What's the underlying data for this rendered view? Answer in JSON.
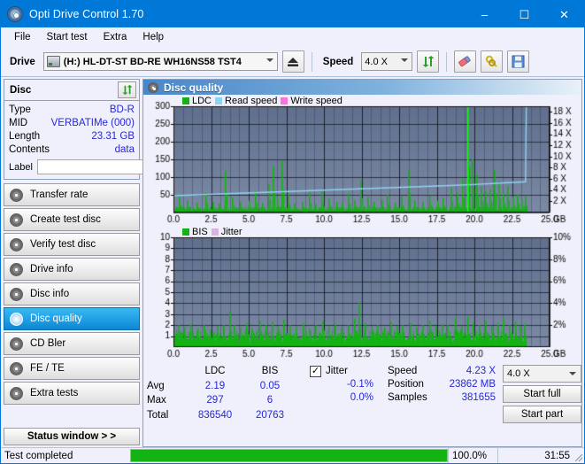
{
  "window": {
    "title": "Opti Drive Control 1.70",
    "icon": "disc-icon",
    "minimize": "–",
    "maximize": "☐",
    "close": "✕"
  },
  "menu": {
    "items": [
      "File",
      "Start test",
      "Extra",
      "Help"
    ]
  },
  "toolbar": {
    "drive_label": "Drive",
    "drive_value": "(H:)  HL-DT-ST BD-RE  WH16NS58 TST4",
    "eject_icon": "eject-icon",
    "speed_label": "Speed",
    "speed_value": "4.0 X",
    "refresh_icon": "refresh-icon",
    "erase_icon": "eraser-icon",
    "tools_icon": "keys-icon",
    "save_icon": "save-icon"
  },
  "disc_panel": {
    "title": "Disc",
    "refresh_icon": "refresh-icon",
    "rows": [
      {
        "key": "Type",
        "value": "BD-R"
      },
      {
        "key": "MID",
        "value": "VERBATIMe (000)"
      },
      {
        "key": "Length",
        "value": "23.31 GB"
      },
      {
        "key": "Contents",
        "value": "data"
      }
    ],
    "label_key": "Label",
    "label_value": "",
    "label_placeholder": "",
    "disc_button_icon": "cd-icon"
  },
  "sidebar": {
    "items": [
      {
        "label": "Transfer rate",
        "icon": "cd-icon",
        "active": false
      },
      {
        "label": "Create test disc",
        "icon": "cd-icon",
        "active": false
      },
      {
        "label": "Verify test disc",
        "icon": "cd-icon",
        "active": false
      },
      {
        "label": "Drive info",
        "icon": "cd-icon",
        "active": false
      },
      {
        "label": "Disc info",
        "icon": "cd-icon",
        "active": false
      },
      {
        "label": "Disc quality",
        "icon": "cd-icon",
        "active": true
      },
      {
        "label": "CD Bler",
        "icon": "cd-icon",
        "active": false
      },
      {
        "label": "FE / TE",
        "icon": "cd-icon",
        "active": false
      },
      {
        "label": "Extra tests",
        "icon": "cd-icon",
        "active": false
      }
    ],
    "status_button": "Status window > >"
  },
  "main": {
    "header_title": "Disc quality",
    "header_icon": "cd-icon"
  },
  "stats": {
    "col_headers": [
      "LDC",
      "BIS"
    ],
    "rows": [
      {
        "label": "Avg",
        "ldc": "2.19",
        "bis": "0.05",
        "jitter": "-0.1%"
      },
      {
        "label": "Max",
        "ldc": "297",
        "bis": "6",
        "jitter": "0.0%"
      },
      {
        "label": "Total",
        "ldc": "836540",
        "bis": "20763",
        "jitter": ""
      }
    ],
    "jitter_label": "Jitter",
    "jitter_checked": true,
    "speed_label": "Speed",
    "speed_value": "4.23 X",
    "position_label": "Position",
    "position_value": "23862 MB",
    "samples_label": "Samples",
    "samples_value": "381655",
    "speed_select": "4.0 X",
    "start_full": "Start full",
    "start_part": "Start part"
  },
  "statusbar": {
    "text": "Test completed",
    "percent_text": "100.0%",
    "percent_value": 100,
    "time": "31:55"
  },
  "colors": {
    "accent": "#0078d7",
    "ldc_green": "#12b312",
    "read_speed": "#8fd3f4",
    "write_speed": "#ff6fe0",
    "jitter": "#d9b3e0",
    "plot_bg": "#6b7b99",
    "value_blue": "#2727d4"
  },
  "chart_data": [
    {
      "type": "bar",
      "title": "Disc quality - LDC",
      "xlabel": "GB",
      "ylabel": "LDC",
      "xlim": [
        0,
        25.0
      ],
      "ylim": [
        0,
        300
      ],
      "xticks": [
        "0.0",
        "2.5",
        "5.0",
        "7.5",
        "10.0",
        "12.5",
        "15.0",
        "17.5",
        "20.0",
        "22.5",
        "25.0"
      ],
      "xtick_unit": "GB",
      "yticks": [
        0,
        50,
        100,
        150,
        200,
        250,
        300
      ],
      "y2ticks": [
        "2 X",
        "4 X",
        "6 X",
        "8 X",
        "10 X",
        "12 X",
        "14 X",
        "16 X",
        "18 X"
      ],
      "y2lim": [
        0,
        19
      ],
      "grid": true,
      "legend": [
        {
          "name": "LDC",
          "color": "#12b312"
        },
        {
          "name": "Read speed",
          "color": "#8fd3f4"
        },
        {
          "name": "Write speed",
          "color": "#ff6fe0"
        }
      ],
      "series": [
        {
          "name": "LDC",
          "kind": "bars",
          "color": "#12b312",
          "baseline": 12,
          "spikes": [
            [
              0.35,
              48
            ],
            [
              0.9,
              35
            ],
            [
              1.5,
              28
            ],
            [
              2.1,
              55
            ],
            [
              2.6,
              30
            ],
            [
              3.0,
              26
            ],
            [
              3.4,
              118
            ],
            [
              3.9,
              44
            ],
            [
              4.4,
              30
            ],
            [
              5.0,
              34
            ],
            [
              5.4,
              60
            ],
            [
              5.9,
              28
            ],
            [
              6.3,
              80
            ],
            [
              6.6,
              132
            ],
            [
              6.9,
              40
            ],
            [
              7.2,
              146
            ],
            [
              7.6,
              52
            ],
            [
              8.0,
              26
            ],
            [
              8.5,
              30
            ],
            [
              9.0,
              58
            ],
            [
              9.4,
              24
            ],
            [
              9.8,
              62
            ],
            [
              10.3,
              40
            ],
            [
              10.8,
              30
            ],
            [
              11.2,
              26
            ],
            [
              11.6,
              55
            ],
            [
              12.0,
              34
            ],
            [
              12.4,
              90
            ],
            [
              12.9,
              44
            ],
            [
              13.3,
              30
            ],
            [
              13.8,
              36
            ],
            [
              14.2,
              52
            ],
            [
              14.7,
              28
            ],
            [
              15.1,
              46
            ],
            [
              15.6,
              120
            ],
            [
              16.0,
              34
            ],
            [
              16.5,
              30
            ],
            [
              17.0,
              48
            ],
            [
              17.5,
              34
            ],
            [
              17.9,
              42
            ],
            [
              18.4,
              70
            ],
            [
              18.8,
              56
            ],
            [
              19.2,
              96
            ],
            [
              19.5,
              290
            ],
            [
              19.8,
              150
            ],
            [
              20.1,
              108
            ],
            [
              20.4,
              72
            ],
            [
              20.7,
              60
            ],
            [
              21.0,
              66
            ],
            [
              21.3,
              120
            ],
            [
              21.6,
              88
            ],
            [
              21.9,
              56
            ],
            [
              22.2,
              74
            ],
            [
              22.5,
              44
            ],
            [
              22.8,
              52
            ],
            [
              23.1,
              38
            ],
            [
              23.35,
              46
            ]
          ]
        },
        {
          "name": "Read speed",
          "kind": "line",
          "color": "#8fd3f4",
          "points": [
            [
              0.0,
              3.0
            ],
            [
              2.0,
              3.2
            ],
            [
              4.0,
              3.4
            ],
            [
              6.0,
              3.6
            ],
            [
              8.0,
              3.8
            ],
            [
              10.0,
              4.0
            ],
            [
              12.0,
              4.2
            ],
            [
              14.0,
              4.4
            ],
            [
              16.0,
              4.6
            ],
            [
              18.0,
              4.8
            ],
            [
              20.0,
              5.0
            ],
            [
              22.0,
              5.3
            ],
            [
              23.4,
              5.5
            ],
            [
              23.45,
              19.0
            ]
          ]
        }
      ]
    },
    {
      "type": "bar",
      "title": "Disc quality - BIS",
      "xlabel": "GB",
      "ylabel": "BIS",
      "xlim": [
        0,
        25.0
      ],
      "ylim": [
        0,
        10
      ],
      "xticks": [
        "0.0",
        "2.5",
        "5.0",
        "7.5",
        "10.0",
        "12.5",
        "15.0",
        "17.5",
        "20.0",
        "22.5",
        "25.0"
      ],
      "xtick_unit": "GB",
      "yticks": [
        1,
        2,
        3,
        4,
        5,
        6,
        7,
        8,
        9,
        10
      ],
      "y2ticks": [
        "2%",
        "4%",
        "6%",
        "8%",
        "10%"
      ],
      "y2lim": [
        0,
        10
      ],
      "grid": true,
      "legend": [
        {
          "name": "BIS",
          "color": "#12b312"
        },
        {
          "name": "Jitter",
          "color": "#d9b3e0"
        }
      ],
      "series": [
        {
          "name": "BIS",
          "kind": "bars",
          "color": "#12b312",
          "baseline": 1.1,
          "spikes": [
            [
              0.3,
              2.0
            ],
            [
              0.7,
              1.8
            ],
            [
              1.1,
              2.1
            ],
            [
              1.6,
              1.7
            ],
            [
              2.0,
              2.0
            ],
            [
              2.4,
              1.6
            ],
            [
              2.9,
              1.9
            ],
            [
              3.3,
              2.0
            ],
            [
              3.7,
              3.2
            ],
            [
              4.0,
              2.0
            ],
            [
              4.4,
              1.8
            ],
            [
              4.8,
              2.2
            ],
            [
              5.2,
              1.7
            ],
            [
              5.7,
              2.4
            ],
            [
              6.1,
              2.0
            ],
            [
              6.5,
              2.3
            ],
            [
              6.9,
              1.9
            ],
            [
              7.3,
              2.5
            ],
            [
              7.7,
              2.0
            ],
            [
              8.1,
              1.8
            ],
            [
              8.6,
              2.2
            ],
            [
              9.0,
              1.7
            ],
            [
              9.4,
              2.0
            ],
            [
              9.9,
              2.4
            ],
            [
              10.3,
              1.9
            ],
            [
              10.7,
              2.1
            ],
            [
              11.1,
              1.8
            ],
            [
              11.6,
              2.0
            ],
            [
              12.0,
              2.6
            ],
            [
              12.3,
              4.1
            ],
            [
              12.7,
              2.2
            ],
            [
              13.1,
              1.9
            ],
            [
              13.5,
              2.0
            ],
            [
              14.0,
              1.8
            ],
            [
              14.4,
              2.3
            ],
            [
              14.8,
              1.9
            ],
            [
              15.2,
              2.0
            ],
            [
              15.7,
              2.2
            ],
            [
              16.1,
              1.8
            ],
            [
              16.5,
              2.0
            ],
            [
              17.0,
              2.4
            ],
            [
              17.4,
              1.9
            ],
            [
              17.8,
              2.1
            ],
            [
              18.2,
              2.0
            ],
            [
              18.7,
              2.6
            ],
            [
              19.1,
              1.9
            ],
            [
              19.5,
              2.8
            ],
            [
              19.9,
              2.2
            ],
            [
              20.3,
              2.0
            ],
            [
              20.7,
              2.4
            ],
            [
              21.1,
              1.9
            ],
            [
              21.5,
              2.1
            ],
            [
              21.9,
              2.6
            ],
            [
              22.3,
              2.0
            ],
            [
              22.7,
              2.3
            ],
            [
              23.0,
              1.9
            ],
            [
              23.3,
              2.1
            ]
          ]
        }
      ]
    }
  ]
}
